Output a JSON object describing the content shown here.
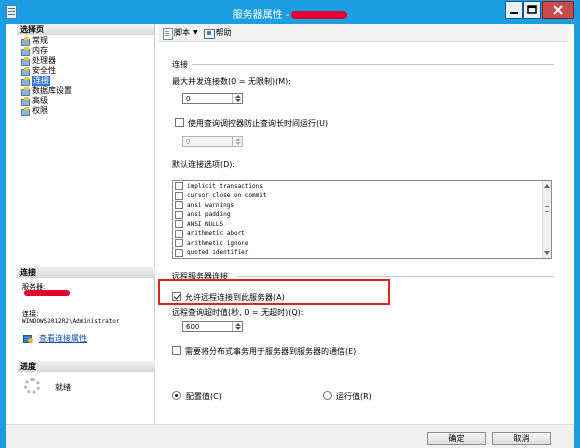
{
  "window": {
    "title": "服务器属性 -"
  },
  "sidebar": {
    "header": "选择页",
    "pages": [
      {
        "label": "常规"
      },
      {
        "label": "内存"
      },
      {
        "label": "处理器"
      },
      {
        "label": "安全性"
      },
      {
        "label": "连接",
        "selected": true
      },
      {
        "label": "数据库设置"
      },
      {
        "label": "高级"
      },
      {
        "label": "权限"
      }
    ],
    "connection_header": "连接",
    "server_label": "服务器:",
    "connection_label": "连接:",
    "connection_value": "WINDOWS2012R2\\Administrator",
    "view_props_link": "查看连接属性",
    "progress_header": "进度",
    "progress_status": "就绪"
  },
  "toolbar": {
    "script_label": "脚本",
    "help_label": "帮助"
  },
  "main": {
    "connections_section": "连接",
    "max_conn_label": "最大并发连接数(0 = 无限制)(M):",
    "max_conn_value": "0",
    "query_governor_label": "使用查询调控器防止查询长时间运行(U)",
    "query_governor_value": "0",
    "default_options_label": "默认连接选项(D):",
    "default_options": [
      "implicit transactions",
      "cursor close on commit",
      "ansi warnings",
      "ansi padding",
      "ANSI NULLS",
      "arithmetic abort",
      "arithmetic ignore",
      "quoted identifier"
    ],
    "remote_section": "远程服务器连接",
    "allow_remote_label": "允许远程连接到此服务器(A)",
    "allow_remote_checked": true,
    "remote_timeout_label": "远程查询超时值(秒, 0 = 无超时)(Q):",
    "remote_timeout_value": "600",
    "distributed_tx_label": "需要将分布式事务用于服务器到服务器的通信(E)",
    "configured_label": "配置值(C)",
    "running_label": "运行值(R)",
    "selected_view": "configured"
  },
  "footer": {
    "ok_label": "确定",
    "cancel_label": "取消"
  }
}
